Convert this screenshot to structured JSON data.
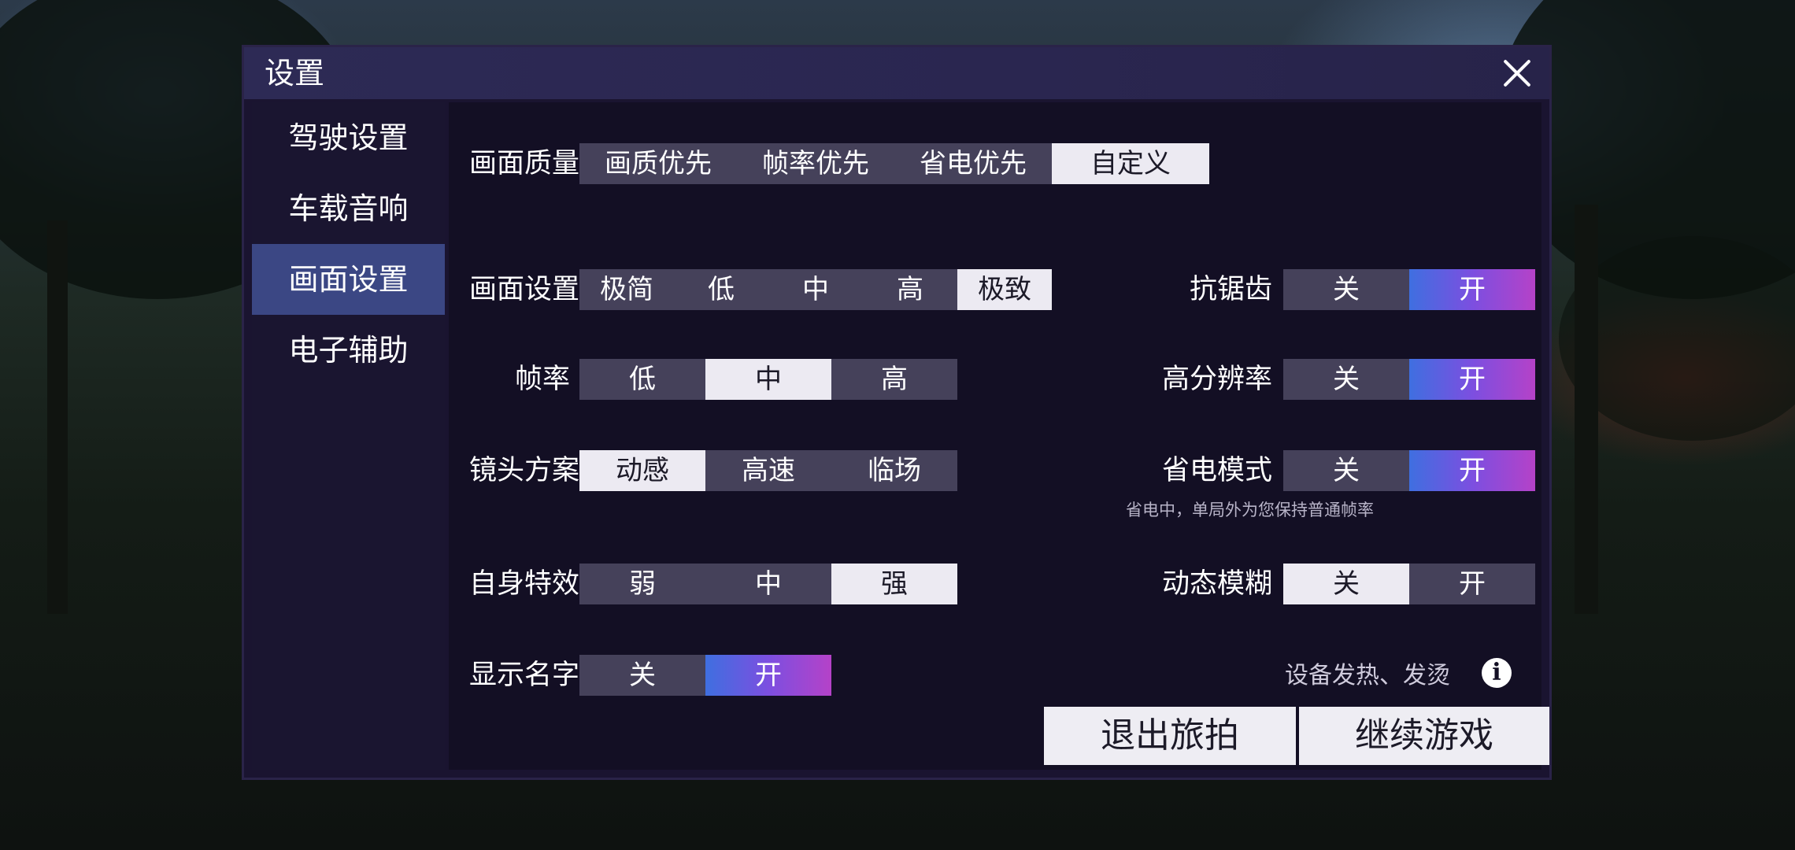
{
  "dialog": {
    "title": "设置"
  },
  "sidebar": {
    "items": [
      {
        "label": "驾驶设置"
      },
      {
        "label": "车载音响"
      },
      {
        "label": "画面设置",
        "active": true
      },
      {
        "label": "电子辅助"
      }
    ]
  },
  "settings": {
    "quality": {
      "label": "画面质量",
      "options": [
        "画质优先",
        "帧率优先",
        "省电优先",
        "自定义"
      ],
      "selected": "自定义"
    },
    "graphics": {
      "label": "画面设置",
      "options": [
        "极简",
        "低",
        "中",
        "高",
        "极致"
      ],
      "selected": "极致"
    },
    "framerate": {
      "label": "帧率",
      "options": [
        "低",
        "中",
        "高"
      ],
      "selected": "中"
    },
    "camera": {
      "label": "镜头方案",
      "options": [
        "动感",
        "高速",
        "临场"
      ],
      "selected": "动感"
    },
    "effects": {
      "label": "自身特效",
      "options": [
        "弱",
        "中",
        "强"
      ],
      "selected": "强"
    },
    "show_names": {
      "label": "显示名字",
      "options": [
        "关",
        "开"
      ],
      "selected": "开"
    },
    "antialias": {
      "label": "抗锯齿",
      "options": [
        "关",
        "开"
      ],
      "selected": "开"
    },
    "highres": {
      "label": "高分辨率",
      "options": [
        "关",
        "开"
      ],
      "selected": "开"
    },
    "powersave": {
      "label": "省电模式",
      "options": [
        "关",
        "开"
      ],
      "selected": "开",
      "hint": "省电中，单局外为您保持普通帧率"
    },
    "motionblur": {
      "label": "动态模糊",
      "options": [
        "关",
        "开"
      ],
      "selected": "关"
    }
  },
  "device_heat": {
    "label": "设备发热、发烫",
    "icon": "info-icon"
  },
  "buttons": {
    "exit": "退出旅拍",
    "continue": "继续游戏"
  },
  "colors": {
    "accent_gradient": [
      "#3f6fe0",
      "#b542c8"
    ],
    "active_tab": "#3b4784",
    "selected_option": "#eceaf2"
  }
}
